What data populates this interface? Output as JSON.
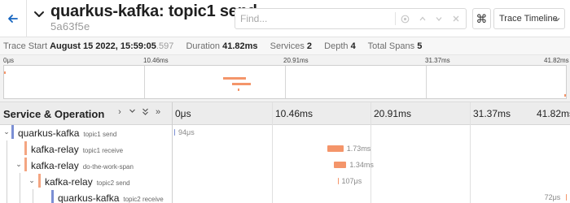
{
  "header": {
    "title": "quarkus-kafka: topic1 send",
    "trace_id": "5a63f5e",
    "find_placeholder": "Find...",
    "keyboard_symbol": "⌘",
    "view_select": "Trace Timeline"
  },
  "summary": {
    "trace_start_label": "Trace Start",
    "trace_start_value": "August 15 2022, 15:59:05",
    "trace_start_ms": ".597",
    "duration_label": "Duration",
    "duration_value": "41.82ms",
    "services_label": "Services",
    "services_value": "2",
    "depth_label": "Depth",
    "depth_value": "4",
    "total_spans_label": "Total Spans",
    "total_spans_value": "5"
  },
  "minimap": {
    "ticks": [
      "0μs",
      "10.46ms",
      "20.91ms",
      "31.37ms",
      "41.82ms"
    ]
  },
  "timeline": {
    "column_title": "Service & Operation",
    "ticks": [
      "0μs",
      "10.46ms",
      "20.91ms",
      "31.37ms",
      "41.82ms"
    ]
  },
  "colors": {
    "quarkus_kafka": "#7b8fd4",
    "kafka_relay": "#f4a582",
    "span_bar": "#f4956a"
  },
  "spans": [
    {
      "service": "quarkus-kafka",
      "operation": "topic1 send",
      "duration": "94μs",
      "start_ms": 0.0,
      "duration_ms": 0.094
    },
    {
      "service": "kafka-relay",
      "operation": "topic1 receive",
      "duration": "1.73ms",
      "start_ms": 16.3,
      "duration_ms": 1.73
    },
    {
      "service": "kafka-relay",
      "operation": "do-the-work-span",
      "duration": "1.34ms",
      "start_ms": 17.0,
      "duration_ms": 1.34
    },
    {
      "service": "kafka-relay",
      "operation": "topic2 send",
      "duration": "107μs",
      "start_ms": 17.4,
      "duration_ms": 0.107
    },
    {
      "service": "quarkus-kafka",
      "operation": "topic2 receive",
      "duration": "72μs",
      "start_ms": 41.7,
      "duration_ms": 0.072
    }
  ]
}
